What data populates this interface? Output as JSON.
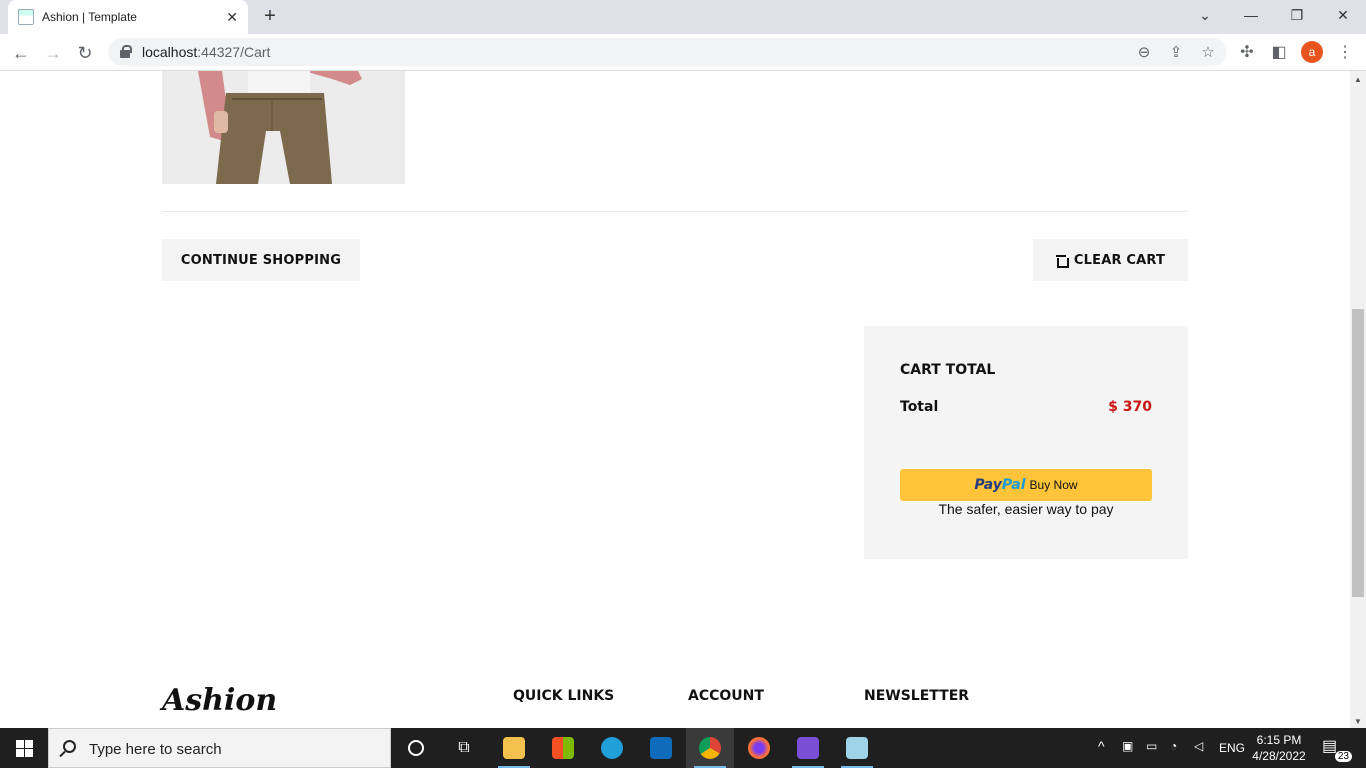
{
  "browser": {
    "tab_title": "Ashion | Template",
    "tab_close": "✕",
    "new_tab": "+",
    "url_host": "localhost",
    "url_rest": ":44327/Cart",
    "avatar_letter": "a"
  },
  "cart": {
    "continue_label": "CONTINUE SHOPPING",
    "clear_label": "CLEAR CART",
    "total_title": "CART TOTAL",
    "total_label": "Total",
    "total_value": "$ 370",
    "paypal_buy_now": "Buy Now",
    "paypal_tagline": "The safer, easier way to pay"
  },
  "footer": {
    "logo": "Ashion",
    "headings": [
      "QUICK LINKS",
      "ACCOUNT",
      "NEWSLETTER"
    ]
  },
  "taskbar": {
    "search_placeholder": "Type here to search",
    "lang": "ENG",
    "time": "6:15 PM",
    "date": "4/28/2022",
    "notification_count": "23"
  },
  "colors": {
    "price_red": "#ca1515",
    "paypal_yellow": "#ffc439",
    "panel_grey": "#f4f4f4"
  }
}
